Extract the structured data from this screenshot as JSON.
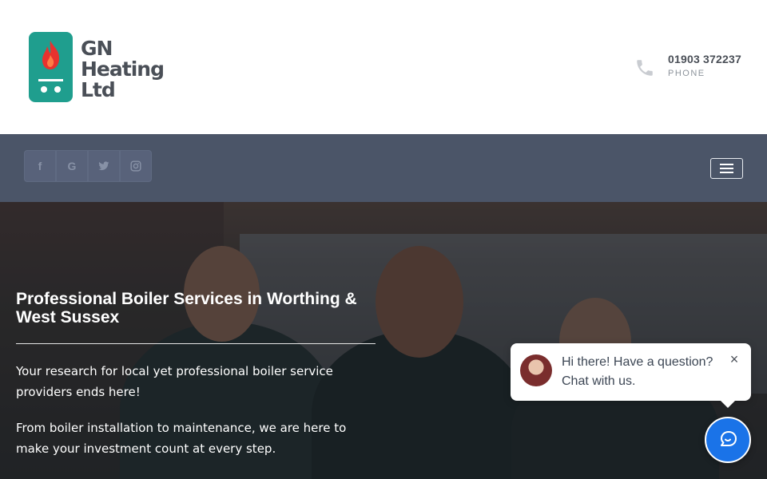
{
  "header": {
    "logo_lines": [
      "GN",
      "Heating",
      "Ltd"
    ],
    "phone_number": "01903 372237",
    "phone_label": "PHONE"
  },
  "navbar": {
    "social": [
      {
        "icon": "facebook-icon",
        "glyph": "f"
      },
      {
        "icon": "google-icon",
        "glyph": "G"
      },
      {
        "icon": "twitter-icon",
        "glyph": "❧"
      },
      {
        "icon": "instagram-icon",
        "glyph": "▣"
      }
    ],
    "menu_icon": "hamburger-icon"
  },
  "hero": {
    "title": "Professional Boiler Services in Worthing & West Sussex",
    "paragraph_1": "Your research for local yet professional boiler service providers ends here!",
    "paragraph_2": "From boiler installation to maintenance, we are here to make your investment count at every step."
  },
  "chat": {
    "message": "Hi there! Have a question? Chat with us.",
    "close_glyph": "×",
    "launcher_icon": "chat-icon"
  },
  "colors": {
    "brand_teal": "#1f9e8e",
    "nav_bg": "#4b5568",
    "chat_blue": "#1a73e8"
  }
}
